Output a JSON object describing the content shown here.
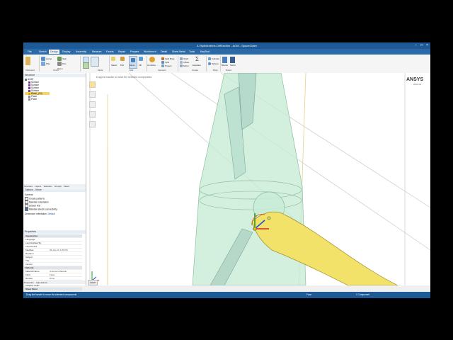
{
  "window": {
    "title": "4-Hydroturbine-DiffSection - AGM - SpaceClaim"
  },
  "menu": {
    "tabs": [
      "File",
      "Sketch",
      "Design",
      "Display",
      "Assembly",
      "Measure",
      "Facets",
      "Repair",
      "Prepare",
      "Workbench",
      "Detail",
      "Sheet Metal",
      "Tools",
      "KeyShot"
    ],
    "active": "Design"
  },
  "ribbon": {
    "groups": [
      "Clipboard",
      "Orient",
      "Mode",
      "Edit",
      "Intersect",
      "Create",
      "Body",
      "Ruled"
    ],
    "orient": [
      "Home",
      "Plan",
      "Zoom",
      "Spin",
      "Pan"
    ],
    "mode": [
      "Sketch Mode",
      "Section Mode",
      "3D Mode"
    ],
    "edit": [
      "Select",
      "Pull",
      "Move",
      "Fill"
    ],
    "intersect": [
      "Combine",
      "Split Body",
      "Split",
      "Project"
    ],
    "create": [
      "Equation",
      "Shell",
      "Offset",
      "Mirror"
    ],
    "body": [
      "Cylinder",
      "Sphere"
    ],
    "ruled": [
      "Blocks",
      "Script"
    ]
  },
  "structure": {
    "header": "Structure",
    "items": [
      {
        "label": "AGM*",
        "color": "#6c757d"
      },
      {
        "label": "Surface",
        "color": "#7a3a9a"
      },
      {
        "label": "Surface",
        "color": "#7a3a9a"
      },
      {
        "label": "Surface",
        "color": "#7a3a9a"
      },
      {
        "label": "Surface",
        "color": "#7a3a9a"
      },
      {
        "label": "Blade_(10)",
        "color": "#e0b000"
      },
      {
        "label": "Plane",
        "color": "#888888"
      },
      {
        "label": "Plane",
        "color": "#888888"
      }
    ]
  },
  "panel_tabs": [
    "Structure",
    "Layers",
    "Selection",
    "Groups",
    "Views"
  ],
  "options": {
    "header": "Options - Move",
    "general": "General",
    "items": [
      "Create patterns",
      "Maintain orientation",
      "Detach first",
      "Maintain sketch connectivity"
    ],
    "dimension_label": "Dimension orientation:",
    "dimension_value": "Default"
  },
  "properties": {
    "header": "Properties",
    "rows": [
      {
        "k": "Appearance",
        "v": "",
        "sec": true
      },
      {
        "k": "Language",
        "v": ""
      },
      {
        "k": "Last Modified By",
        "v": ""
      },
      {
        "k": "Last Printed",
        "v": ""
      },
      {
        "k": "Modified",
        "v": "06-Jun-21 3:25 PM"
      },
      {
        "k": "Revision",
        "v": ""
      },
      {
        "k": "Subject",
        "v": ""
      },
      {
        "k": "Title",
        "v": ""
      },
      {
        "k": "Version",
        "v": ""
      },
      {
        "k": "Material",
        "v": "",
        "sec": true
      },
      {
        "k": "Material Name",
        "v": "Unknown Material"
      },
      {
        "k": "Fluid",
        "v": "False"
      },
      {
        "k": "Density",
        "v": "None"
      },
      {
        "k": "Name",
        "v": "",
        "sec": true
      },
      {
        "k": "Instance Suffix",
        "v": ""
      },
      {
        "k": "Sheet Metal",
        "v": "",
        "sec": true
      }
    ],
    "tabs": [
      "Properties",
      "Appearance"
    ]
  },
  "viewport": {
    "hint": "Drag the handle to move the selected components",
    "brand": "ANSYS",
    "brand_version": "2021 R1",
    "document_tab": "AGM*"
  },
  "statusbar": {
    "message": "Drag the handle to move the selected components",
    "mid": "Face",
    "right": "1 Component"
  }
}
